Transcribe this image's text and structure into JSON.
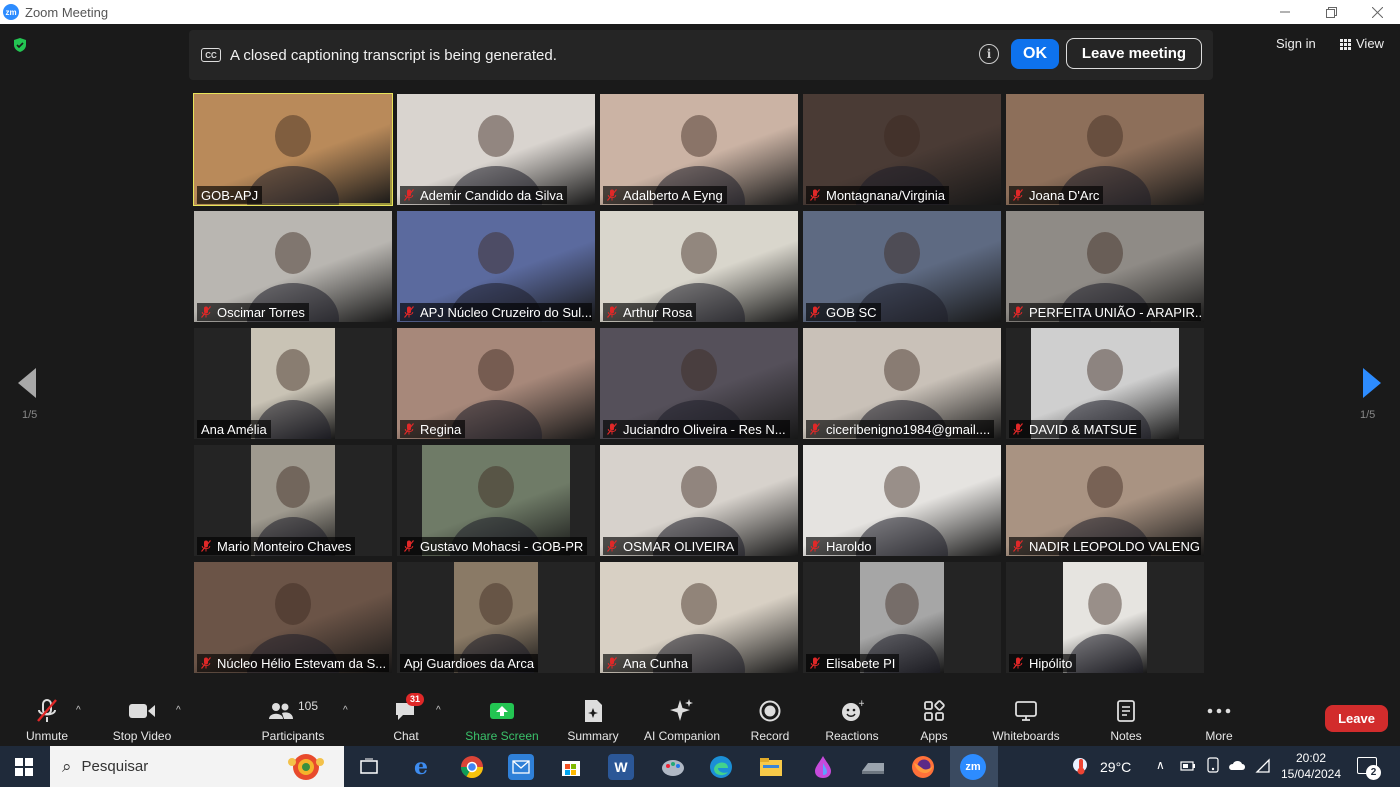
{
  "window": {
    "title": "Zoom Meeting",
    "logo": "zm"
  },
  "caption_banner": {
    "cc_icon": "CC",
    "message": "A closed captioning transcript is being generated.",
    "info_icon": "i",
    "ok_label": "OK",
    "leave_label": "Leave meeting"
  },
  "header": {
    "sign_in": "Sign in",
    "view": "View"
  },
  "pagination": {
    "left": "1/5",
    "right": "1/5"
  },
  "tiles": [
    {
      "name": "GOB-APJ",
      "muted": false,
      "active": true,
      "bg": "#b98a5a"
    },
    {
      "name": "Ademir Candido da Silva",
      "muted": true,
      "bg": "#d9d4cf"
    },
    {
      "name": "Adalberto A Eyng",
      "muted": true,
      "bg": "#cbb3a4"
    },
    {
      "name": "Montagnana/Virginia",
      "muted": true,
      "bg": "#4a3b35"
    },
    {
      "name": "Joana D'Arc",
      "muted": true,
      "bg": "#8d6f5a"
    },
    {
      "name": "Oscimar Torres",
      "muted": true,
      "bg": "#b9b6b1"
    },
    {
      "name": "APJ Núcleo Cruzeiro do Sul...",
      "muted": true,
      "bg": "#5b6a9e"
    },
    {
      "name": "Arthur Rosa",
      "muted": true,
      "bg": "#d9d6cc"
    },
    {
      "name": "GOB SC",
      "muted": true,
      "bg": "#5e6a82"
    },
    {
      "name": "PERFEITA UNIÃO - ARAPIR...",
      "muted": true,
      "bg": "#8f8b86"
    },
    {
      "name": "Ana Amélia",
      "muted": false,
      "bg": "#c9c3b5",
      "narrow": true
    },
    {
      "name": "Regina",
      "muted": true,
      "bg": "#a7887a"
    },
    {
      "name": "Juciandro Oliveira - Res N...",
      "muted": true,
      "bg": "#55505a"
    },
    {
      "name": "ciceribenigno1984@gmail....",
      "muted": true,
      "bg": "#c9c1b8"
    },
    {
      "name": "DAVID & MATSUE",
      "muted": true,
      "bg": "#cfcfcf",
      "narrow": true,
      "wide_narrow": true
    },
    {
      "name": "Mario Monteiro Chaves",
      "muted": true,
      "bg": "#9f9a8f",
      "narrow": true
    },
    {
      "name": "Gustavo Mohacsi - GOB-PR",
      "muted": true,
      "bg": "#6f7b67",
      "narrow": true,
      "wide_narrow": true
    },
    {
      "name": "OSMAR OLIVEIRA",
      "muted": true,
      "bg": "#d7d2cc"
    },
    {
      "name": "Haroldo",
      "muted": true,
      "bg": "#e5e3e0"
    },
    {
      "name": "NADIR LEOPOLDO VALENG...",
      "muted": true,
      "bg": "#a99382"
    },
    {
      "name": "Núcleo Hélio Estevam da S...",
      "muted": true,
      "bg": "#6b5447"
    },
    {
      "name": "Apj Guardioes da Arca",
      "muted": false,
      "bg": "#8a7a66",
      "narrow": true
    },
    {
      "name": "Ana Cunha",
      "muted": true,
      "bg": "#d8d0c4"
    },
    {
      "name": "Elisabete  PI",
      "muted": true,
      "bg": "#a6a6a6",
      "narrow": true
    },
    {
      "name": "Hipólito",
      "muted": true,
      "bg": "#e6e4e0",
      "narrow": true
    }
  ],
  "toolbar": {
    "unmute": "Unmute",
    "stop_video": "Stop Video",
    "participants": "Participants",
    "participants_count": "105",
    "chat": "Chat",
    "chat_badge": "31",
    "share_screen": "Share Screen",
    "summary": "Summary",
    "ai_companion": "AI Companion",
    "record": "Record",
    "reactions": "Reactions",
    "apps": "Apps",
    "whiteboards": "Whiteboards",
    "notes": "Notes",
    "more": "More",
    "leave": "Leave"
  },
  "taskbar": {
    "search_placeholder": "Pesquisar",
    "temperature": "29°C",
    "time": "20:02",
    "date": "15/04/2024",
    "notifications": "2",
    "apps": [
      "task-view",
      "edge-legacy",
      "chrome",
      "mail",
      "store",
      "word",
      "paint",
      "edge",
      "files",
      "drop",
      "drive",
      "firefox",
      "zoom"
    ]
  }
}
